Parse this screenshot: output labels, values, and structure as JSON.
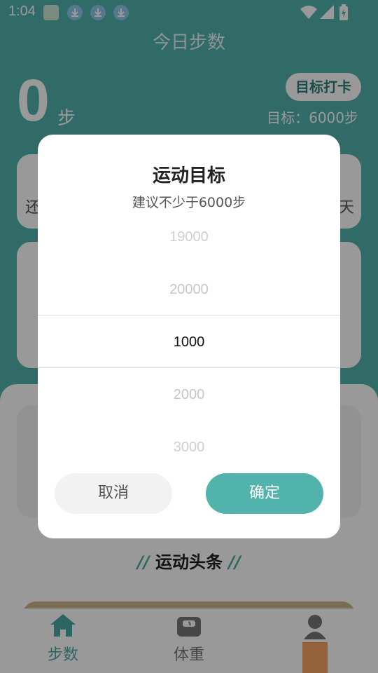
{
  "status_bar": {
    "time": "1:04"
  },
  "header": {
    "title": "今日步数",
    "steps_value": "0",
    "steps_unit": "步",
    "checkin_button": "目标打卡",
    "goal_text": "目标：6000步",
    "card_left_label": "还",
    "card_right_label": "天"
  },
  "news": {
    "title": "运动头条",
    "slash": "//"
  },
  "bottom_nav": {
    "steps_label": "步数",
    "weight_label": "体重"
  },
  "dialog": {
    "title": "运动目标",
    "subtitle": "建议不少于6000步",
    "picker_items": [
      "19000",
      "20000",
      "1000",
      "2000",
      "3000"
    ],
    "selected_value": "1000",
    "cancel_label": "取消",
    "confirm_label": "确定"
  },
  "colors": {
    "accent": "#52b3ad",
    "orange": "#f7a261"
  }
}
